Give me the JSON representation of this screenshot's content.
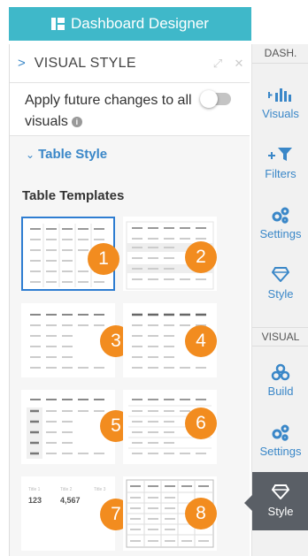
{
  "header": {
    "title": "Dashboard Designer"
  },
  "panel": {
    "title": "VISUAL STYLE",
    "expand_icon": "expand-icon",
    "close_icon": "close-icon",
    "apply_text": "Apply future changes to all visuals",
    "apply_toggle_on": false,
    "section_label": "Table Style",
    "templates_heading": "Table Templates",
    "templates": [
      {
        "number": "1",
        "selected": true
      },
      {
        "number": "2",
        "selected": false
      },
      {
        "number": "3",
        "selected": false
      },
      {
        "number": "4",
        "selected": false
      },
      {
        "number": "5",
        "selected": false
      },
      {
        "number": "6",
        "selected": false
      },
      {
        "number": "7",
        "selected": false,
        "kpi": [
          {
            "label": "Title 1",
            "value": "123"
          },
          {
            "label": "Title 2",
            "value": "4,567"
          },
          {
            "label": "Title 3",
            "value": ""
          }
        ]
      },
      {
        "number": "8",
        "selected": false
      }
    ]
  },
  "rail": {
    "dash_label": "DASH.",
    "visual_label": "VISUAL",
    "dash_items": [
      {
        "label": "Visuals",
        "icon": "bar-chart-plus-icon"
      },
      {
        "label": "Filters",
        "icon": "filter-plus-icon"
      },
      {
        "label": "Settings",
        "icon": "gears-icon"
      },
      {
        "label": "Style",
        "icon": "diamond-icon"
      }
    ],
    "visual_items": [
      {
        "label": "Build",
        "icon": "build-icon"
      },
      {
        "label": "Settings",
        "icon": "gears-icon"
      },
      {
        "label": "Style",
        "icon": "diamond-icon",
        "active": true
      }
    ]
  },
  "colors": {
    "header": "#3fb8c9",
    "accent": "#3a87c8",
    "badge": "#f28c1f",
    "selected_border": "#2e7dd1",
    "active_rail": "#5a5f66"
  }
}
